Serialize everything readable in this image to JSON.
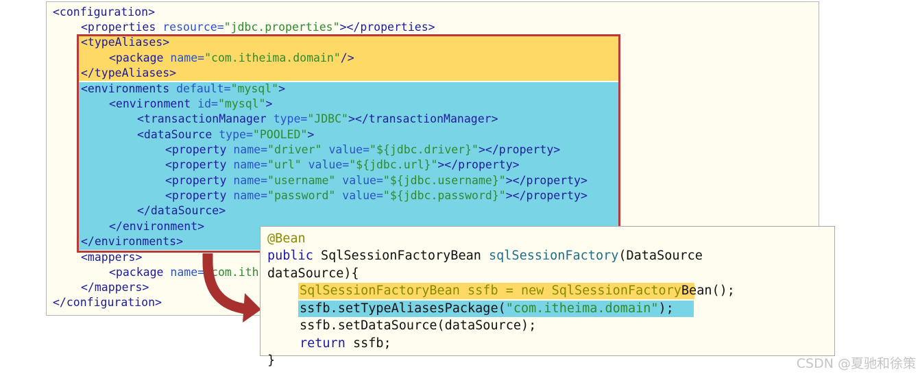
{
  "xml_config": {
    "lines": [
      [
        {
          "t": "<configuration>"
        }
      ],
      [
        {
          "t": "<properties "
        },
        {
          "t": "resource=",
          "c": "at"
        },
        {
          "t": "\"jdbc.properties\"",
          "c": "av"
        },
        {
          "t": "></properties>"
        }
      ],
      [
        {
          "t": "<typeAliases>"
        }
      ],
      [
        {
          "t": "<package "
        },
        {
          "t": "name=",
          "c": "at"
        },
        {
          "t": "\"com.itheima.domain\"",
          "c": "av"
        },
        {
          "t": "/>"
        }
      ],
      [
        {
          "t": "</typeAliases>"
        }
      ],
      [
        {
          "t": "<environments "
        },
        {
          "t": "default=",
          "c": "at"
        },
        {
          "t": "\"mysql\"",
          "c": "av"
        },
        {
          "t": ">"
        }
      ],
      [
        {
          "t": "<environment "
        },
        {
          "t": "id=",
          "c": "at"
        },
        {
          "t": "\"mysql\"",
          "c": "av"
        },
        {
          "t": ">"
        }
      ],
      [
        {
          "t": "<transactionManager "
        },
        {
          "t": "type=",
          "c": "at"
        },
        {
          "t": "\"JDBC\"",
          "c": "av"
        },
        {
          "t": "></transactionManager>"
        }
      ],
      [
        {
          "t": "<dataSource "
        },
        {
          "t": "type=",
          "c": "at"
        },
        {
          "t": "\"POOLED\"",
          "c": "av"
        },
        {
          "t": ">"
        }
      ],
      [
        {
          "t": "<property "
        },
        {
          "t": "name=",
          "c": "at"
        },
        {
          "t": "\"driver\"",
          "c": "av"
        },
        {
          "t": " "
        },
        {
          "t": "value=",
          "c": "at"
        },
        {
          "t": "\"${jdbc.driver}\"",
          "c": "av"
        },
        {
          "t": "></property>"
        }
      ],
      [
        {
          "t": "<property "
        },
        {
          "t": "name=",
          "c": "at"
        },
        {
          "t": "\"url\"",
          "c": "av"
        },
        {
          "t": " "
        },
        {
          "t": "value=",
          "c": "at"
        },
        {
          "t": "\"${jdbc.url}\"",
          "c": "av"
        },
        {
          "t": "></property>"
        }
      ],
      [
        {
          "t": "<property "
        },
        {
          "t": "name=",
          "c": "at"
        },
        {
          "t": "\"username\"",
          "c": "av"
        },
        {
          "t": " "
        },
        {
          "t": "value=",
          "c": "at"
        },
        {
          "t": "\"${jdbc.username}\"",
          "c": "av"
        },
        {
          "t": "></property>"
        }
      ],
      [
        {
          "t": "<property "
        },
        {
          "t": "name=",
          "c": "at"
        },
        {
          "t": "\"password\"",
          "c": "av"
        },
        {
          "t": " "
        },
        {
          "t": "value=",
          "c": "at"
        },
        {
          "t": "\"${jdbc.password}\"",
          "c": "av"
        },
        {
          "t": "></property>"
        }
      ],
      [
        {
          "t": "</dataSource>"
        }
      ],
      [
        {
          "t": "</environment>"
        }
      ],
      [
        {
          "t": "</environments>"
        }
      ],
      [
        {
          "t": "<mappers>"
        }
      ],
      [
        {
          "t": "<package "
        },
        {
          "t": "name=",
          "c": "at"
        },
        {
          "t": "\"com.ith",
          "c": "av"
        }
      ],
      [
        {
          "t": "</mappers>"
        }
      ],
      [
        {
          "t": "</configuration>"
        }
      ]
    ]
  },
  "java_code": {
    "lines": [
      [
        {
          "t": "@Bean",
          "c": "ann"
        }
      ],
      [
        {
          "t": "public",
          "c": "kw"
        },
        {
          "t": " SqlSessionFactoryBean "
        },
        {
          "t": "sqlSessionFactory",
          "c": "fn"
        },
        {
          "t": "(DataSource"
        }
      ],
      [
        {
          "t": "dataSource){"
        }
      ],
      [
        {
          "t": "SqlSessionFactoryBean ssfb = ",
          "c": "ann"
        },
        {
          "t": "new",
          "c": "ann"
        },
        {
          "t": " SqlSessionFactory",
          "c": "ann"
        },
        {
          "t": "Bean();"
        }
      ],
      [
        {
          "t": "ssfb.setTypeAliasesPackage("
        },
        {
          "t": "\"com.itheima.domain\"",
          "c": "str"
        },
        {
          "t": ");"
        }
      ],
      [
        {
          "t": "ssfb.setDataSource(dataSource);"
        }
      ],
      [
        {
          "t": "return",
          "c": "kw"
        },
        {
          "t": " ssfb;"
        }
      ],
      [
        {
          "t": "}"
        }
      ]
    ]
  },
  "colors": {
    "highlight_yellow": "#ffd966",
    "highlight_blue": "#79d5e6",
    "frame_red": "#b83a3a",
    "arrow_red": "#a8302f"
  },
  "icons": [
    "curved-arrow-icon"
  ],
  "watermark": "CSDN @夏驰和徐策"
}
